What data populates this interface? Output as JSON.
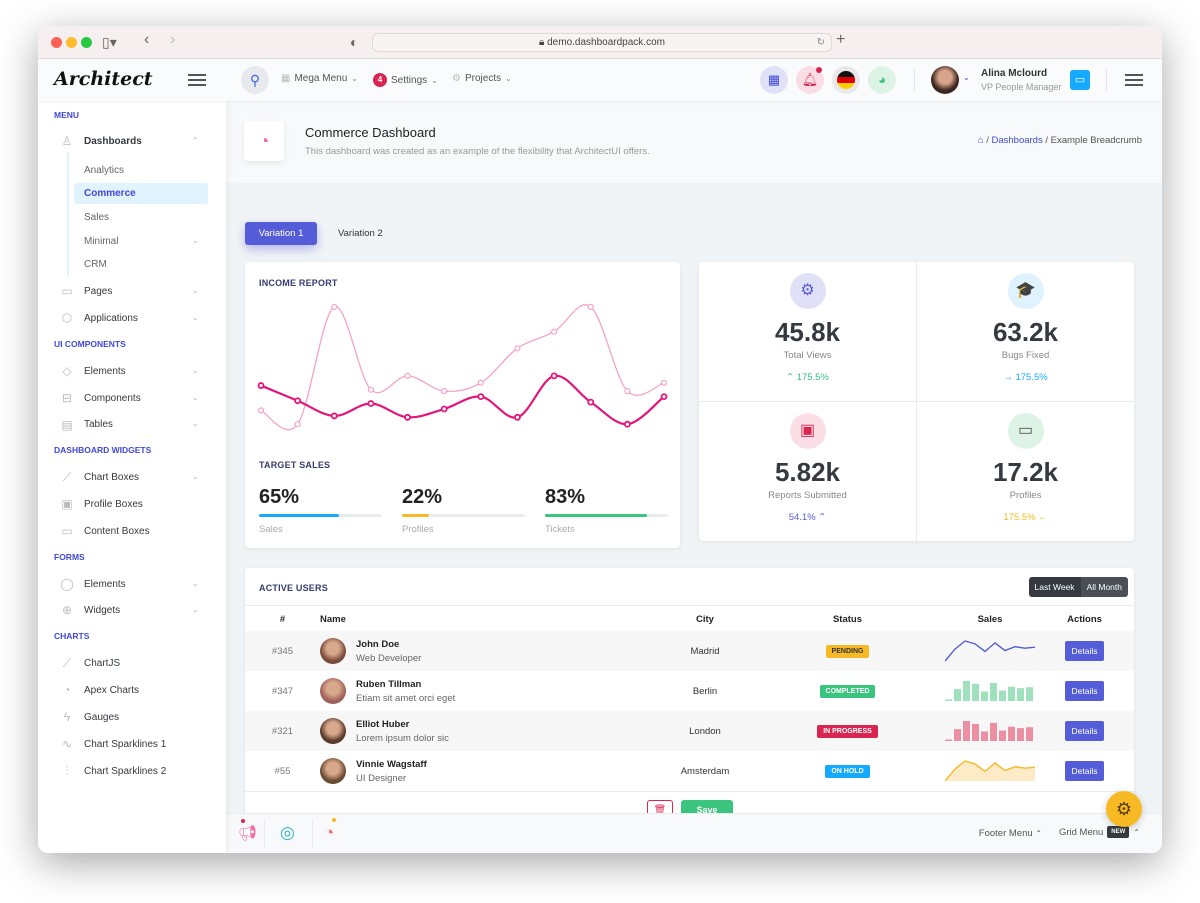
{
  "browser": {
    "url": "demo.dashboardpack.com"
  },
  "header": {
    "logo": "Architect",
    "menus": [
      {
        "label": "Mega Menu",
        "icon": "gift-icon"
      },
      {
        "label": "Settings",
        "badge": "4"
      },
      {
        "label": "Projects",
        "icon": "cog-icon"
      }
    ],
    "user": {
      "name": "Alina Mclourd",
      "role": "VP People Manager"
    }
  },
  "sidebar": {
    "sections": [
      {
        "title": "MENU"
      },
      {
        "title": "UI COMPONENTS"
      },
      {
        "title": "DASHBOARD WIDGETS"
      },
      {
        "title": "FORMS"
      },
      {
        "title": "CHARTS"
      }
    ],
    "dashboards": "Dashboards",
    "sub_items": [
      "Analytics",
      "Commerce",
      "Sales",
      "Minimal",
      "CRM"
    ],
    "items": {
      "pages": "Pages",
      "applications": "Applications",
      "elements": "Elements",
      "components": "Components",
      "tables": "Tables",
      "chart_boxes": "Chart Boxes",
      "profile_boxes": "Profile Boxes",
      "content_boxes": "Content Boxes",
      "form_elements": "Elements",
      "widgets": "Widgets",
      "chartjs": "ChartJS",
      "apex": "Apex Charts",
      "gauges": "Gauges",
      "spark1": "Chart Sparklines 1",
      "spark2": "Chart Sparklines 2"
    }
  },
  "page": {
    "title": "Commerce Dashboard",
    "subtitle": "This dashboard was created as an example of the flexibility that ArchitectUI offers.",
    "breadcrumb": [
      "Dashboards",
      "Example Breadcrumb"
    ],
    "tabs": [
      "Variation 1",
      "Variation 2"
    ]
  },
  "income": {
    "title": "INCOME REPORT",
    "target_title": "TARGET SALES",
    "targets": [
      {
        "value": "65%",
        "label": "Sales",
        "pct": 65,
        "color": "#3ac47d"
      },
      {
        "value": "22%",
        "label": "Profiles",
        "pct": 22,
        "color": "#f7b924"
      },
      {
        "value": "83%",
        "label": "Tickets",
        "pct": 83,
        "color": "#3ac47d"
      }
    ]
  },
  "chart_data": {
    "type": "line",
    "title": "INCOME REPORT",
    "x": [
      1,
      2,
      3,
      4,
      5,
      6,
      7,
      8,
      9,
      10,
      11,
      12
    ],
    "series": [
      {
        "name": "series-light",
        "color": "#f5a3c7",
        "values": [
          20,
          10,
          95,
          35,
          45,
          34,
          40,
          65,
          77,
          95,
          34,
          40
        ]
      },
      {
        "name": "series-dark",
        "color": "#e3157c",
        "values": [
          38,
          27,
          16,
          25,
          15,
          21,
          30,
          15,
          45,
          26,
          10,
          30
        ]
      }
    ],
    "ylim": [
      0,
      100
    ]
  },
  "stats": [
    {
      "value": "45.8k",
      "label": "Total Views",
      "change": "175.5%",
      "arrow": "▲",
      "color": "#3ac47d",
      "icon_bg": "#e0e1f6",
      "icon_color": "#545cd8",
      "icon": "⚙"
    },
    {
      "value": "63.2k",
      "label": "Bugs Fixed",
      "change": "175.5%",
      "arrow": "→",
      "color": "#16aaff",
      "icon_bg": "#dff2ff",
      "icon_color": "#16aaff",
      "icon": "🎓"
    },
    {
      "value": "5.82k",
      "label": "Reports Submitted",
      "change": "54.1%",
      "arrow": "▲",
      "color": "#545cd8",
      "icon_bg": "#fbdde5",
      "icon_color": "#d92550",
      "icon": "▣"
    },
    {
      "value": "17.2k",
      "label": "Profiles",
      "change": "175.5%",
      "arrow": "←",
      "color": "#f7b924",
      "icon_bg": "#dcf3e5",
      "icon_color": "#555",
      "icon": "▭"
    }
  ],
  "users": {
    "title": "ACTIVE USERS",
    "toggle": [
      "Last Week",
      "All Month"
    ],
    "columns": [
      "#",
      "Name",
      "City",
      "Status",
      "Sales",
      "Actions"
    ],
    "rows": [
      {
        "id": "#345",
        "name": "John Doe",
        "sub": "Web Developer",
        "city": "Madrid",
        "status": "PENDING",
        "status_color": "#f7b924",
        "status_text": "#333",
        "spark": "line",
        "spark_color": "#545cd8",
        "action": "Details"
      },
      {
        "id": "#347",
        "name": "Ruben Tillman",
        "sub": "Etiam sit amet orci eget",
        "city": "Berlin",
        "status": "COMPLETED",
        "status_color": "#3ac47d",
        "status_text": "#fff",
        "spark": "bar",
        "spark_color": "#9fe0bd",
        "action": "Details"
      },
      {
        "id": "#321",
        "name": "Elliot Huber",
        "sub": "Lorem ipsum dolor sic",
        "city": "London",
        "status": "IN PROGRESS",
        "status_color": "#d92550",
        "status_text": "#fff",
        "spark": "bar",
        "spark_color": "#ec8fa3",
        "action": "Details"
      },
      {
        "id": "#55",
        "name": "Vinnie Wagstaff",
        "sub": "UI Designer",
        "city": "Amsterdam",
        "status": "ON HOLD",
        "status_color": "#16aaff",
        "status_text": "#fff",
        "spark": "area",
        "spark_color": "#f7b924",
        "action": "Details"
      }
    ],
    "spark_values": [
      0,
      25,
      42,
      36,
      20,
      38,
      22,
      30,
      27,
      29
    ],
    "save_label": "Save"
  },
  "footer": {
    "footer_menu": "Footer Menu",
    "grid_menu": "Grid Menu",
    "new_badge": "NEW"
  }
}
